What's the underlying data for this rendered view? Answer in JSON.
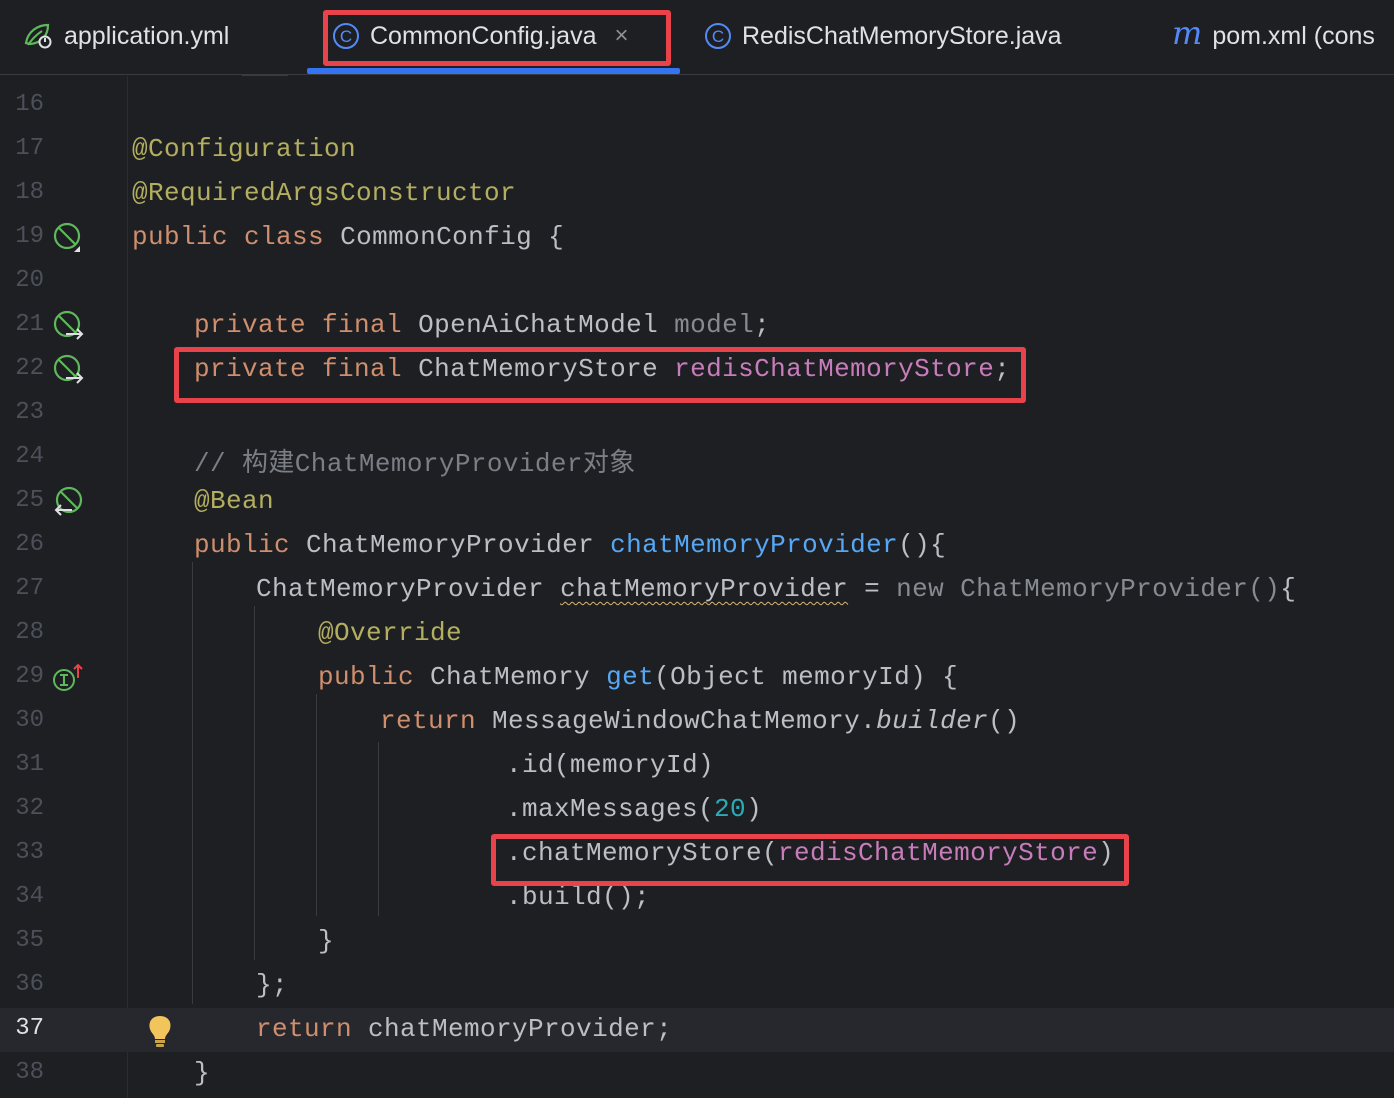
{
  "tabs": [
    {
      "label": "application.yml",
      "icon": "spring-config-icon",
      "active": false
    },
    {
      "label": "CommonConfig.java",
      "icon": "class-icon",
      "active": true,
      "close": "×"
    },
    {
      "label": "RedisChatMemoryStore.java",
      "icon": "class-icon",
      "active": false
    },
    {
      "label": "pom.xml (cons",
      "icon": "maven-icon",
      "active": false,
      "icon_glyph": "m"
    }
  ],
  "class_icon_glyph": "C",
  "gutter": {
    "line_numbers": [
      "16",
      "17",
      "18",
      "19",
      "20",
      "21",
      "22",
      "23",
      "24",
      "25",
      "26",
      "27",
      "28",
      "29",
      "30",
      "31",
      "32",
      "33",
      "34",
      "35",
      "36",
      "37",
      "38"
    ],
    "current_line": "37"
  },
  "code": {
    "l17": {
      "ann": "@Configuration"
    },
    "l18": {
      "ann": "@RequiredArgsConstructor"
    },
    "l19": {
      "kw1": "public",
      "kw2": "class",
      "name": "CommonConfig",
      "brace": " {"
    },
    "l21": {
      "kw1": "private",
      "kw2": "final",
      "type": "OpenAiChatModel",
      "field": "model",
      "end": ";"
    },
    "l22": {
      "kw1": "private",
      "kw2": "final",
      "type": "ChatMemoryStore",
      "field": "redisChatMemoryStore",
      "end": ";"
    },
    "l24": {
      "comment": "// 构建ChatMemoryProvider对象"
    },
    "l25": {
      "ann": "@Bean"
    },
    "l26": {
      "kw1": "public",
      "type": "ChatMemoryProvider",
      "method": "chatMemoryProvider",
      "end": "(){"
    },
    "l27": {
      "type": "ChatMemoryProvider",
      "var": "chatMemoryProvider",
      "eq": " = ",
      "kw": "new",
      "ctor": "ChatMemoryProvider()",
      "end": "{"
    },
    "l28": {
      "ann": "@Override"
    },
    "l29": {
      "kw1": "public",
      "type": "ChatMemory",
      "method": "get",
      "params": "(Object memoryId) {"
    },
    "l30": {
      "kw": "return",
      "cls": "MessageWindowChatMemory.",
      "method": "builder",
      "end": "()"
    },
    "l31": {
      "text": ".id(memoryId)"
    },
    "l32": {
      "pre": ".maxMessages(",
      "num": "20",
      "end": ")"
    },
    "l33": {
      "pre": ".chatMemoryStore(",
      "field": "redisChatMemoryStore",
      "end": ")"
    },
    "l34": {
      "text": ".build();"
    },
    "l35": {
      "text": "}"
    },
    "l36": {
      "text": "};"
    },
    "l37": {
      "kw": "return",
      "text": "chatMemoryProvider;"
    },
    "l38": {
      "text": "}"
    }
  },
  "colors": {
    "background": "#1e1f22",
    "keyword": "#cf8e6d",
    "annotation": "#b3ae60",
    "field": "#c77dbb",
    "method": "#56a8f5",
    "number": "#2aacb8",
    "comment": "#7a7e85",
    "highlight_box": "#e8434b",
    "active_tab_underline": "#3574f0"
  }
}
